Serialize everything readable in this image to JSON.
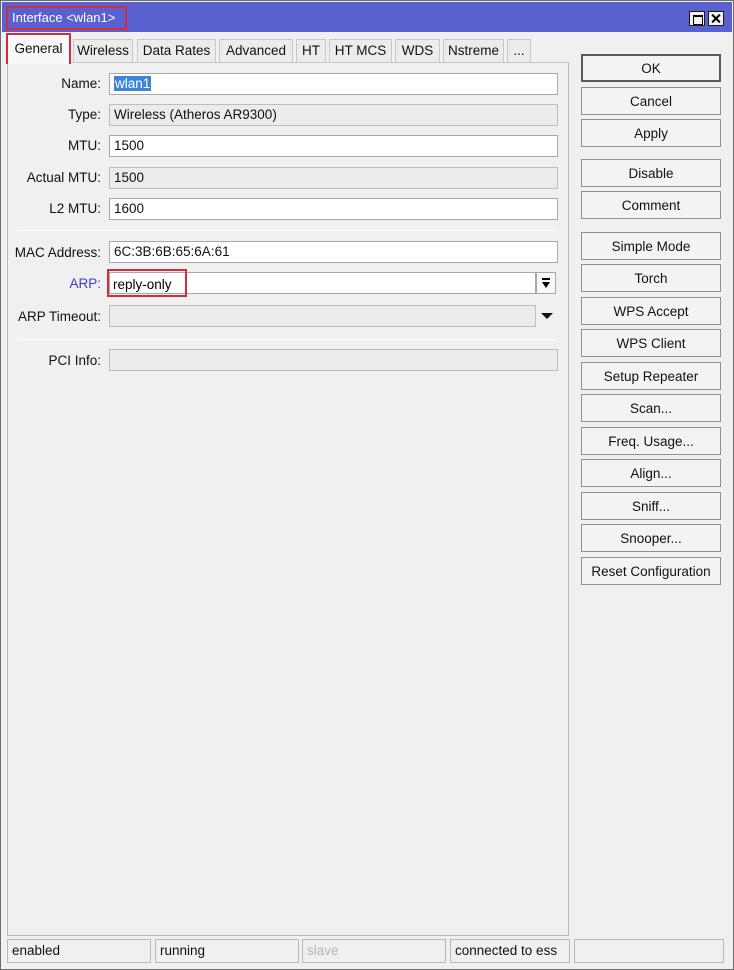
{
  "window": {
    "title": "Interface <wlan1>"
  },
  "tabs": [
    {
      "label": "General"
    },
    {
      "label": "Wireless"
    },
    {
      "label": "Data Rates"
    },
    {
      "label": "Advanced"
    },
    {
      "label": "HT"
    },
    {
      "label": "HT MCS"
    },
    {
      "label": "WDS"
    },
    {
      "label": "Nstreme"
    },
    {
      "label": "..."
    }
  ],
  "form": {
    "name": {
      "label": "Name:",
      "value": "wlan1"
    },
    "type": {
      "label": "Type:",
      "value": "Wireless (Atheros AR9300)"
    },
    "mtu": {
      "label": "MTU:",
      "value": "1500"
    },
    "actual_mtu": {
      "label": "Actual MTU:",
      "value": "1500"
    },
    "l2_mtu": {
      "label": "L2 MTU:",
      "value": "1600"
    },
    "mac_address": {
      "label": "MAC Address:",
      "value": "6C:3B:6B:65:6A:61"
    },
    "arp": {
      "label": "ARP:",
      "value": "reply-only"
    },
    "arp_timeout": {
      "label": "ARP Timeout:",
      "value": ""
    },
    "pci_info": {
      "label": "PCI Info:",
      "value": ""
    }
  },
  "buttons": {
    "ok": "OK",
    "cancel": "Cancel",
    "apply": "Apply",
    "disable": "Disable",
    "comment": "Comment",
    "simple_mode": "Simple Mode",
    "torch": "Torch",
    "wps_accept": "WPS Accept",
    "wps_client": "WPS Client",
    "setup_repeater": "Setup Repeater",
    "scan": "Scan...",
    "freq_usage": "Freq. Usage...",
    "align": "Align...",
    "sniff": "Sniff...",
    "snooper": "Snooper...",
    "reset_configuration": "Reset Configuration"
  },
  "status_bar": {
    "enabled": "enabled",
    "running": "running",
    "slave": "slave",
    "connection": "connected to ess",
    "extra": ""
  },
  "colors": {
    "titlebar": "#5960cf",
    "highlight_border": "#d32c3c",
    "link_label": "#3e3ec8",
    "selection": "#3f84d6"
  }
}
